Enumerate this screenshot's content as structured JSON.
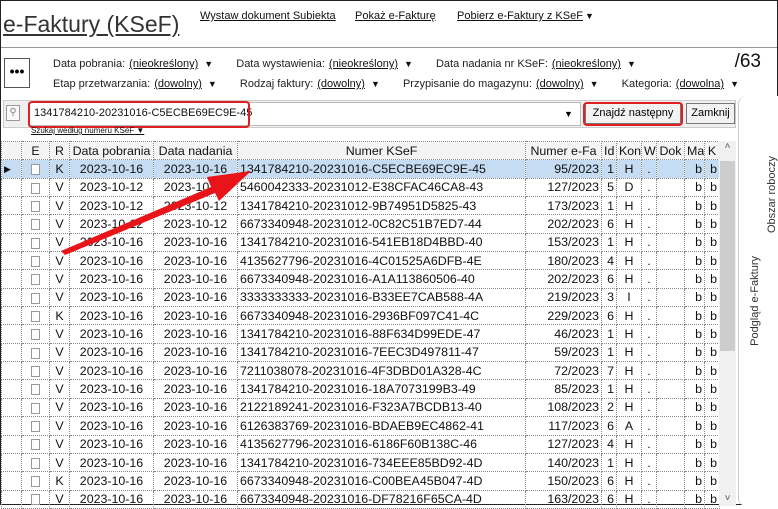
{
  "header": {
    "title": "e-Faktury (KSeF)",
    "links": [
      "Wystaw dokument Subiekta",
      "Pokaż e-Fakturę",
      "Pobierz e-Faktury z KSeF"
    ],
    "count": "/63",
    "more_label": "•••"
  },
  "filters": {
    "row1": [
      {
        "label": "Data pobrania:",
        "value": "(nieokreślony)"
      },
      {
        "label": "Data wystawienia:",
        "value": "(nieokreślony)"
      },
      {
        "label": "Data nadania nr KSeF:",
        "value": "(nieokreślony)"
      }
    ],
    "row2": [
      {
        "label": "Etap przetwarzania:",
        "value": "(dowolny)"
      },
      {
        "label": "Rodzaj faktury:",
        "value": "(dowolny)"
      },
      {
        "label": "Przypisanie do magazynu:",
        "value": "(dowolny)"
      },
      {
        "label": "Kategoria:",
        "value": "(dowolna)"
      }
    ]
  },
  "search": {
    "value": "1341784210-20231016-C5ECBE69EC9E-45",
    "find_next": "Znajdź następny",
    "close": "Zamknij",
    "mode": "Szukaj według numeru KSeF"
  },
  "table": {
    "columns": [
      "E",
      "R",
      "Data pobrania",
      "Data nadania",
      "Numer KSeF",
      "Numer e-Fa",
      "Id",
      "Kon",
      "W",
      "Dok",
      "Ma",
      "K"
    ],
    "rows": [
      [
        "K",
        "2023-10-16",
        "2023-10-16",
        "1341784210-20231016-C5ECBE69EC9E-45",
        "95/2023",
        "1",
        "H",
        ".",
        "",
        "b",
        "b"
      ],
      [
        "V",
        "2023-10-12",
        "2023-10-12",
        "5460042333-20231012-E38CFAC46CA8-43",
        "127/2023",
        "5",
        "D",
        ".",
        "",
        "b",
        "b"
      ],
      [
        "V",
        "2023-10-12",
        "2023-10-12",
        "1341784210-20231012-9B74951D5825-43",
        "173/2023",
        "1",
        "H",
        ".",
        "",
        "b",
        "b"
      ],
      [
        "V",
        "2023-10-12",
        "2023-10-12",
        "6673340948-20231012-0C82C51B7ED7-44",
        "202/2023",
        "6",
        "H",
        ".",
        "",
        "b",
        "b"
      ],
      [
        "V",
        "2023-10-16",
        "2023-10-16",
        "1341784210-20231016-541EB18D4BBD-40",
        "153/2023",
        "1",
        "H",
        ".",
        "",
        "b",
        "b"
      ],
      [
        "V",
        "2023-10-16",
        "2023-10-16",
        "4135627796-20231016-4C01525A6DFB-4E",
        "180/2023",
        "4",
        "H",
        ".",
        "",
        "b",
        "b"
      ],
      [
        "V",
        "2023-10-16",
        "2023-10-16",
        "6673340948-20231016-A1A113860506-40",
        "202/2023",
        "6",
        "H",
        ".",
        "",
        "b",
        "b"
      ],
      [
        "V",
        "2023-10-16",
        "2023-10-16",
        "3333333333-20231016-B33EE7CAB588-4A",
        "219/2023",
        "3",
        "I",
        ".",
        "",
        "b",
        "b"
      ],
      [
        "K",
        "2023-10-16",
        "2023-10-16",
        "6673340948-20231016-2936BF097C41-4C",
        "229/2023",
        "6",
        "H",
        ".",
        "",
        "b",
        "b"
      ],
      [
        "V",
        "2023-10-16",
        "2023-10-16",
        "1341784210-20231016-88F634D99EDE-47",
        "46/2023",
        "1",
        "H",
        ".",
        "",
        "b",
        "b"
      ],
      [
        "V",
        "2023-10-16",
        "2023-10-16",
        "1341784210-20231016-7EEC3D497811-47",
        "59/2023",
        "1",
        "H",
        ".",
        "",
        "b",
        "b"
      ],
      [
        "V",
        "2023-10-16",
        "2023-10-16",
        "7211038078-20231016-4F3DBD01A328-4C",
        "72/2023",
        "7",
        "H",
        ".",
        "",
        "b",
        "b"
      ],
      [
        "V",
        "2023-10-16",
        "2023-10-16",
        "1341784210-20231016-18A7073199B3-49",
        "85/2023",
        "1",
        "H",
        ".",
        "",
        "b",
        "b"
      ],
      [
        "V",
        "2023-10-16",
        "2023-10-16",
        "2122189241-20231016-F323A7BCDB13-40",
        "108/2023",
        "2",
        "H",
        ".",
        "",
        "b",
        "b"
      ],
      [
        "V",
        "2023-10-16",
        "2023-10-16",
        "6126383769-20231016-BDAEB9EC4862-41",
        "117/2023",
        "6",
        "A",
        ".",
        "",
        "b",
        "b"
      ],
      [
        "V",
        "2023-10-16",
        "2023-10-16",
        "4135627796-20231016-6186F60B138C-46",
        "127/2023",
        "4",
        "H",
        ".",
        "",
        "b",
        "b"
      ],
      [
        "V",
        "2023-10-16",
        "2023-10-16",
        "1341784210-20231016-734EEE85BD92-4D",
        "140/2023",
        "1",
        "H",
        ".",
        "",
        "b",
        "b"
      ],
      [
        "K",
        "2023-10-16",
        "2023-10-16",
        "6673340948-20231016-C00BEA45B047-4D",
        "150/2023",
        "6",
        "H",
        ".",
        "",
        "b",
        "b"
      ],
      [
        "V",
        "2023-10-16",
        "2023-10-16",
        "6673340948-20231016-DF78216F65CA-4D",
        "163/2023",
        "6",
        "H",
        ".",
        "",
        "b",
        "b"
      ]
    ]
  },
  "side_tabs": [
    "Podgląd e-Faktury",
    "Obszar roboczy"
  ],
  "colors": {
    "highlight": "#e02020",
    "selected_row": "#c6dcf2"
  }
}
